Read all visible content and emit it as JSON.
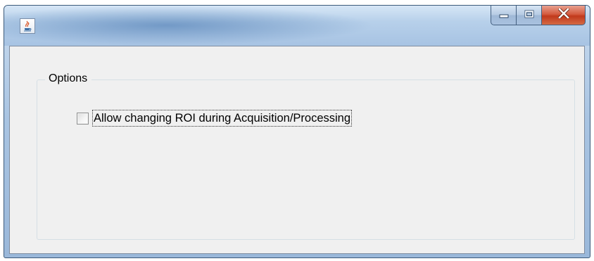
{
  "window": {
    "title": "",
    "icon": "java-cup-icon",
    "controls": {
      "minimize": "minimize-icon",
      "maximize": "maximize-icon",
      "close": "close-icon"
    }
  },
  "options": {
    "group_title": "Options",
    "allow_roi_change": {
      "label": "Allow changing ROI during Acquisition/Processing",
      "checked": false
    }
  },
  "colors": {
    "close_button": "#c13a1c",
    "client_background": "#f0f0f0",
    "titlebar": "#a9c4e2"
  }
}
